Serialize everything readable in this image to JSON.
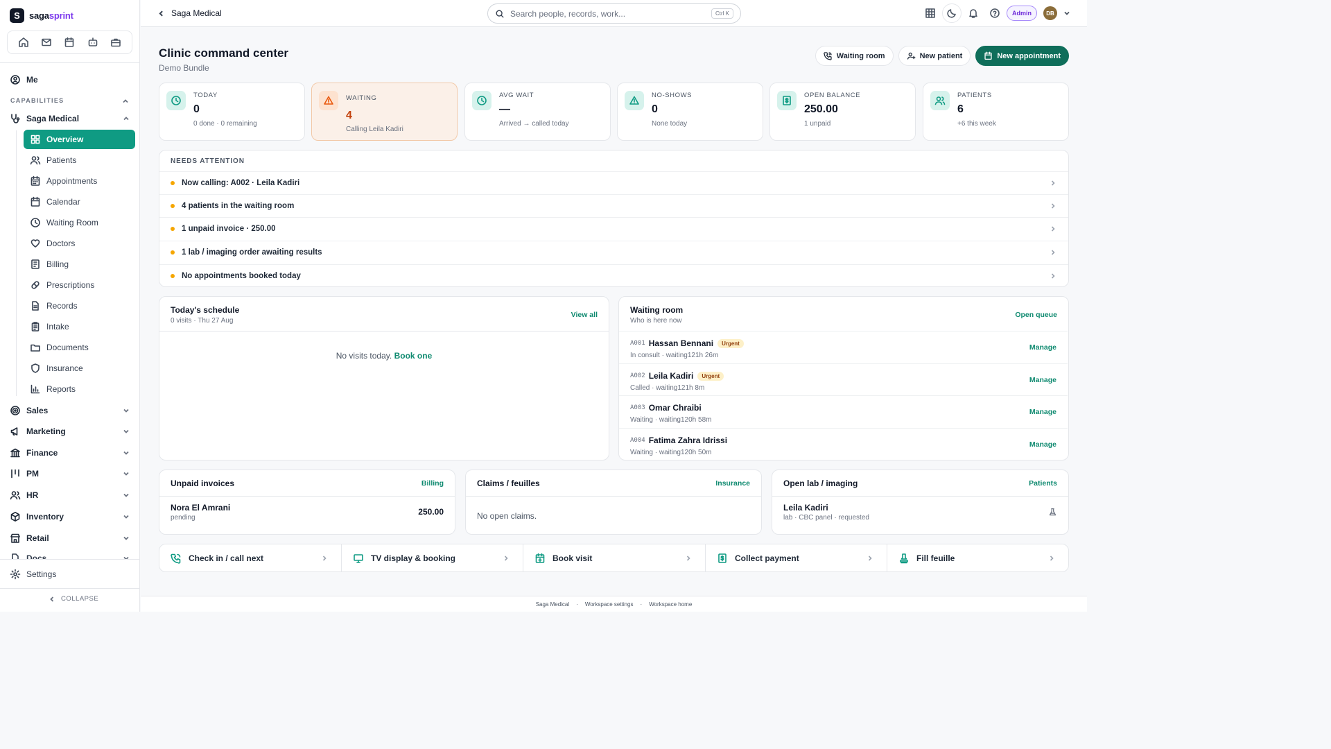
{
  "app": {
    "brand_prefix": "saga",
    "brand_accent": "sprint",
    "logo_letter": "S"
  },
  "sidebar": {
    "me_label": "Me",
    "capabilities_label": "CAPABILITIES",
    "group_label": "Saga Medical",
    "items": [
      {
        "label": "Overview",
        "icon": "grid-icon",
        "active": true
      },
      {
        "label": "Patients",
        "icon": "users-icon"
      },
      {
        "label": "Appointments",
        "icon": "calendar-icon"
      },
      {
        "label": "Calendar",
        "icon": "calendar-icon"
      },
      {
        "label": "Waiting Room",
        "icon": "clock-icon"
      },
      {
        "label": "Doctors",
        "icon": "stethoscope-icon"
      },
      {
        "label": "Billing",
        "icon": "receipt-icon"
      },
      {
        "label": "Prescriptions",
        "icon": "pill-icon"
      },
      {
        "label": "Records",
        "icon": "file-icon"
      },
      {
        "label": "Intake",
        "icon": "clipboard-icon"
      },
      {
        "label": "Documents",
        "icon": "folder-icon"
      },
      {
        "label": "Insurance",
        "icon": "shield-icon"
      },
      {
        "label": "Reports",
        "icon": "bar-chart-icon"
      }
    ],
    "sections": [
      "Sales",
      "Marketing",
      "Finance",
      "PM",
      "HR",
      "Inventory",
      "Retail",
      "Docs"
    ],
    "settings_label": "Settings",
    "collapse_label": "COLLAPSE"
  },
  "topbar": {
    "crumb": "Saga Medical",
    "search_placeholder": "Search people, records, work...",
    "search_shortcut": "Ctrl K",
    "role_badge": "Admin",
    "avatar_initials": "DB"
  },
  "header": {
    "title": "Clinic command center",
    "subtitle": "Demo Bundle",
    "buttons": {
      "waiting_room": "Waiting room",
      "new_patient": "New patient",
      "new_appointment": "New appointment"
    }
  },
  "kpis": [
    {
      "label": "TODAY",
      "value": "0",
      "sub": "0 done · 0 remaining",
      "icon": "clock-icon"
    },
    {
      "label": "WAITING",
      "value": "4",
      "sub": "Calling Leila Kadiri",
      "icon": "alert-icon"
    },
    {
      "label": "AVG WAIT",
      "value": "—",
      "sub": "Arrived → called today",
      "icon": "clock-icon"
    },
    {
      "label": "NO-SHOWS",
      "value": "0",
      "sub": "None today",
      "icon": "alert-icon"
    },
    {
      "label": "OPEN BALANCE",
      "value": "250.00",
      "sub": "1 unpaid",
      "icon": "receipt-icon"
    },
    {
      "label": "PATIENTS",
      "value": "6",
      "sub": "+6 this week",
      "icon": "users-icon"
    }
  ],
  "attention": {
    "heading": "NEEDS ATTENTION",
    "items": [
      "Now calling: A002 · Leila Kadiri",
      "4 patients in the waiting room",
      "1 unpaid invoice · 250.00",
      "1 lab / imaging order awaiting results",
      "No appointments booked today"
    ]
  },
  "schedule": {
    "title": "Today's schedule",
    "sub": "0 visits · Thu 27 Aug",
    "link": "View all",
    "empty_text": "No visits today.",
    "empty_link": "Book one"
  },
  "waiting_room": {
    "title": "Waiting room",
    "sub": "Who is here now",
    "link": "Open queue",
    "action_label": "Manage",
    "rows": [
      {
        "code": "A001",
        "name": "Hassan Bennani",
        "badge": "Urgent",
        "status": "In consult · waiting121h 26m"
      },
      {
        "code": "A002",
        "name": "Leila Kadiri",
        "badge": "Urgent",
        "status": "Called · waiting121h 8m"
      },
      {
        "code": "A003",
        "name": "Omar Chraibi",
        "badge": "",
        "status": "Waiting · waiting120h 58m"
      },
      {
        "code": "A004",
        "name": "Fatima Zahra Idrissi",
        "badge": "",
        "status": "Waiting · waiting120h 50m"
      }
    ]
  },
  "unpaid": {
    "title": "Unpaid invoices",
    "link": "Billing",
    "name": "Nora El Amrani",
    "status": "pending",
    "amount": "250.00"
  },
  "claims": {
    "title": "Claims / feuilles",
    "link": "Insurance",
    "empty_text": "No open claims."
  },
  "lab": {
    "title": "Open lab / imaging",
    "link": "Patients",
    "name": "Leila Kadiri",
    "detail": "lab · CBC panel · requested"
  },
  "quick_actions": [
    {
      "label": "Check in / call next",
      "icon": "phone-icon"
    },
    {
      "label": "TV display & booking",
      "icon": "monitor-icon"
    },
    {
      "label": "Book visit",
      "icon": "calendar-plus-icon"
    },
    {
      "label": "Collect payment",
      "icon": "receipt-icon"
    },
    {
      "label": "Fill feuille",
      "icon": "stamp-icon"
    }
  ],
  "footer": {
    "links": [
      "Saga Medical",
      "Workspace settings",
      "Workspace home"
    ],
    "separator": "·"
  },
  "colors": {
    "accent": "#0f9b83",
    "primary_button": "#0f6e5a",
    "warning": "#f5a600",
    "brand": "#7c3aed"
  }
}
